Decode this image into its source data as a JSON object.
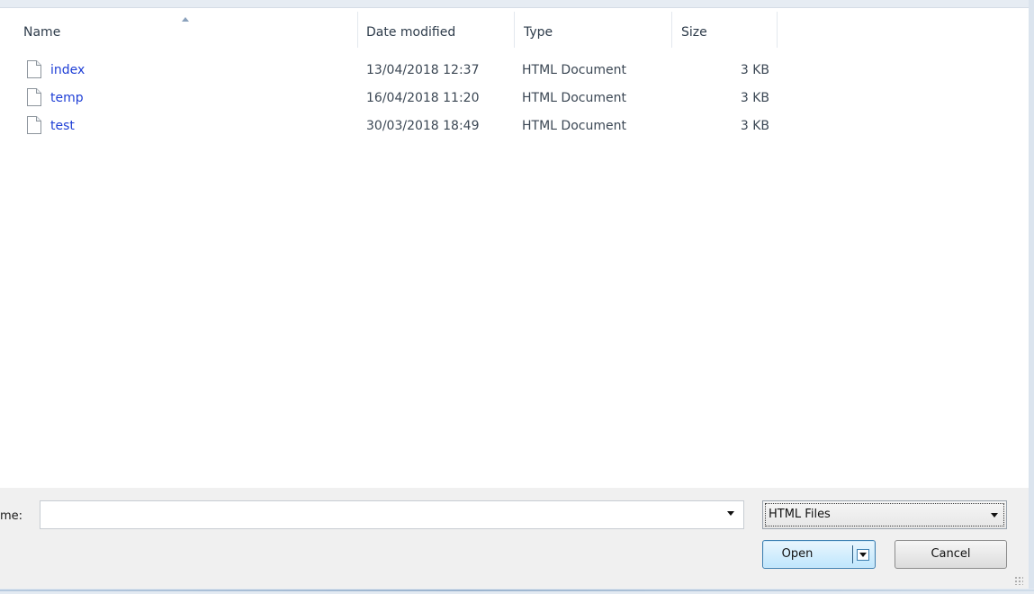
{
  "columns": {
    "name": "Name",
    "date_modified": "Date modified",
    "type": "Type",
    "size": "Size"
  },
  "files": [
    {
      "name": "index",
      "date_modified": "13/04/2018 12:37",
      "type": "HTML Document",
      "size": "3 KB",
      "icon": "file-icon"
    },
    {
      "name": "temp",
      "date_modified": "16/04/2018 11:20",
      "type": "HTML Document",
      "size": "3 KB",
      "icon": "file-icon"
    },
    {
      "name": "test",
      "date_modified": "30/03/2018 18:49",
      "type": "HTML Document",
      "size": "3 KB",
      "icon": "file-icon"
    }
  ],
  "bottom": {
    "filename_label": "me:",
    "filename_value": "",
    "filter_selected": "HTML Files",
    "open_label": "Open",
    "cancel_label": "Cancel"
  },
  "colors": {
    "link": "#1f3fd6",
    "accent_border": "#3c7fb1"
  }
}
